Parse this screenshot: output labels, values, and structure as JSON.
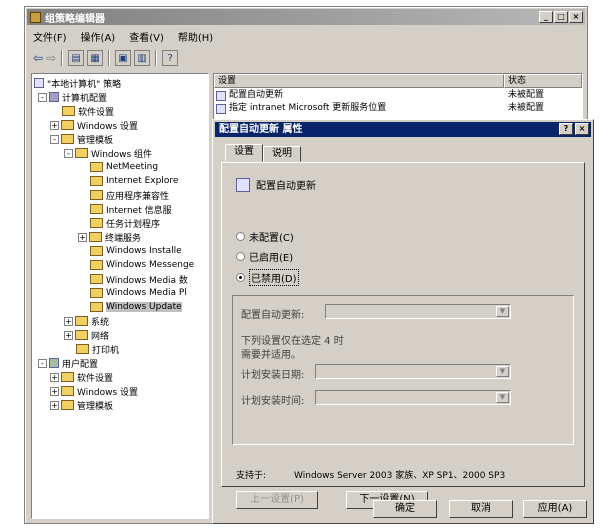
{
  "window": {
    "title": "组策略编辑器",
    "controls": [
      "_",
      "□",
      "×"
    ]
  },
  "menu": [
    "文件(F)",
    "操作(A)",
    "查看(V)",
    "帮助(H)"
  ],
  "toolbar_icons": [
    "back-icon",
    "forward-icon",
    "up-folder-icon",
    "show-tree-icon",
    "properties-icon",
    "export-icon",
    "help-icon"
  ],
  "tree": {
    "root": "\"本地计算机\" 策略",
    "computer_config": "计算机配置",
    "software_settings": "软件设置",
    "windows_settings": "Windows 设置",
    "admin_templates": "管理模板",
    "windows_components": "Windows 组件",
    "components": [
      "NetMeeting",
      "Internet Explore",
      "应用程序兼容性",
      "Internet 信息服",
      "任务计划程序",
      "终端服务",
      "Windows Installe",
      "Windows Messenge",
      "Windows Media 数",
      "Windows Media Pl",
      "Windows Update"
    ],
    "system": "系统",
    "network": "网络",
    "printers": "打印机",
    "user_config": "用户配置",
    "user_software": "软件设置",
    "user_windows": "Windows 设置",
    "user_admin": "管理模板"
  },
  "list": {
    "col_setting": "设置",
    "col_state": "状态",
    "rows": [
      {
        "setting": "配置自动更新",
        "state": "未被配置"
      },
      {
        "setting": "指定 intranet Microsoft 更新服务位置",
        "state": "未被配置"
      }
    ]
  },
  "dialog": {
    "title": "配置自动更新 属性",
    "help_btn": "?",
    "close_btn": "×",
    "tab_setting": "设置",
    "tab_explain": "说明",
    "setting_name": "配置自动更新",
    "radio_not_configured": "未配置(C)",
    "radio_enabled": "已启用(E)",
    "radio_disabled": "已禁用(D)",
    "configure_label": "配置自动更新:",
    "note_line1": "下列设置仅在选定 4 时",
    "note_line2": "需要并适用。",
    "schedule_day_label": "计划安装日期:",
    "schedule_time_label": "计划安装时间:",
    "supported_label": "支持于:",
    "supported_value": "Windows Server 2003 家族、XP SP1、2000 SP3",
    "prev_btn": "上一设置(P)",
    "next_btn": "下一设置(N)",
    "ok_btn": "确定",
    "cancel_btn": "取消",
    "apply_btn": "应用(A)"
  }
}
